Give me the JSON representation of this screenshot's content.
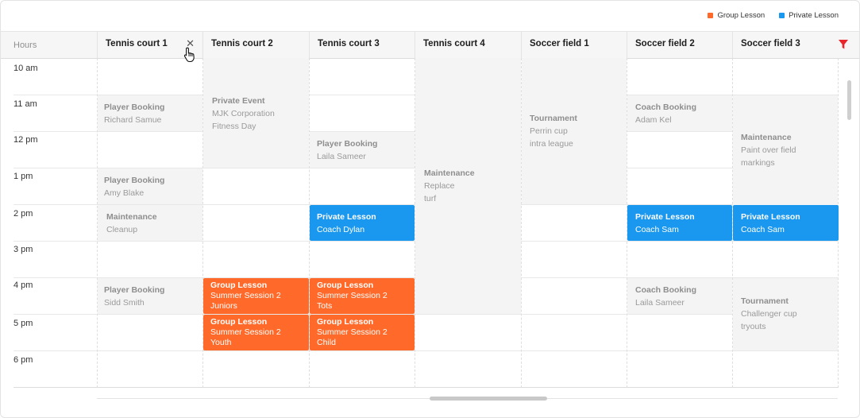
{
  "legend": [
    {
      "label": "Group Lesson",
      "color": "#ff6a2a"
    },
    {
      "label": "Private Lesson",
      "color": "#1a97ee"
    }
  ],
  "header": {
    "hours_label": "Hours",
    "columns": [
      "Tennis court 1",
      "Tennis court 2",
      "Tennis court 3",
      "Tennis court 4",
      "Soccer field 1",
      "Soccer field 2",
      "Soccer field 3"
    ],
    "close_icon": "close-icon",
    "filter_icon": "filter-icon",
    "filter_color": "#e8262b"
  },
  "hours": [
    "10 am",
    "11 am",
    "12 pm",
    "1 pm",
    "2 pm",
    "3 pm",
    "4 pm",
    "5 pm",
    "6 pm"
  ],
  "events": [
    {
      "id": "tc1-player-1",
      "title": "Player Booking",
      "details": [
        "Richard Samue"
      ],
      "type": "gray"
    },
    {
      "id": "tc1-player-2",
      "title": "Player Booking",
      "details": [
        "Amy Blake"
      ],
      "type": "gray"
    },
    {
      "id": "tc1-maint",
      "title": "Maintenance",
      "details": [
        "Cleanup"
      ],
      "type": "gray"
    },
    {
      "id": "tc1-player-3",
      "title": "Player Booking",
      "details": [
        "Sidd Smith"
      ],
      "type": "gray"
    },
    {
      "id": "tc2-private-event",
      "title": "Private Event",
      "details": [
        "MJK Corporation",
        "Fitness Day"
      ],
      "type": "gray"
    },
    {
      "id": "tc2-group-1",
      "title": "Group Lesson",
      "details": [
        "Summer Session 2",
        "Juniors"
      ],
      "type": "group"
    },
    {
      "id": "tc2-group-2",
      "title": "Group Lesson",
      "details": [
        "Summer Session 2",
        "Youth"
      ],
      "type": "group"
    },
    {
      "id": "tc3-player",
      "title": "Player Booking",
      "details": [
        "Laila Sameer"
      ],
      "type": "gray"
    },
    {
      "id": "tc3-private",
      "title": "Private Lesson",
      "details": [
        "Coach Dylan"
      ],
      "type": "private"
    },
    {
      "id": "tc3-group-1",
      "title": "Group Lesson",
      "details": [
        "Summer Session 2",
        "Tots"
      ],
      "type": "group"
    },
    {
      "id": "tc3-group-2",
      "title": "Group Lesson",
      "details": [
        "Summer Session 2",
        "Child"
      ],
      "type": "group"
    },
    {
      "id": "tc4-maint",
      "title": "Maintenance",
      "details": [
        "Replace",
        "turf"
      ],
      "type": "gray"
    },
    {
      "id": "sf1-tournament",
      "title": "Tournament",
      "details": [
        "Perrin cup",
        "intra league"
      ],
      "type": "gray"
    },
    {
      "id": "sf2-coach-1",
      "title": "Coach Booking",
      "details": [
        "Adam Kel"
      ],
      "type": "gray"
    },
    {
      "id": "sf2-private",
      "title": "Private Lesson",
      "details": [
        "Coach Sam"
      ],
      "type": "private"
    },
    {
      "id": "sf2-coach-2",
      "title": "Coach Booking",
      "details": [
        "Laila Sameer"
      ],
      "type": "gray"
    },
    {
      "id": "sf3-maint",
      "title": "Maintenance",
      "details": [
        "Paint over field",
        "markings"
      ],
      "type": "gray"
    },
    {
      "id": "sf3-private",
      "title": "Private Lesson",
      "details": [
        "Coach Sam"
      ],
      "type": "private"
    },
    {
      "id": "sf3-tournament",
      "title": "Tournament",
      "details": [
        "Challenger cup",
        "tryouts"
      ],
      "type": "gray"
    }
  ]
}
